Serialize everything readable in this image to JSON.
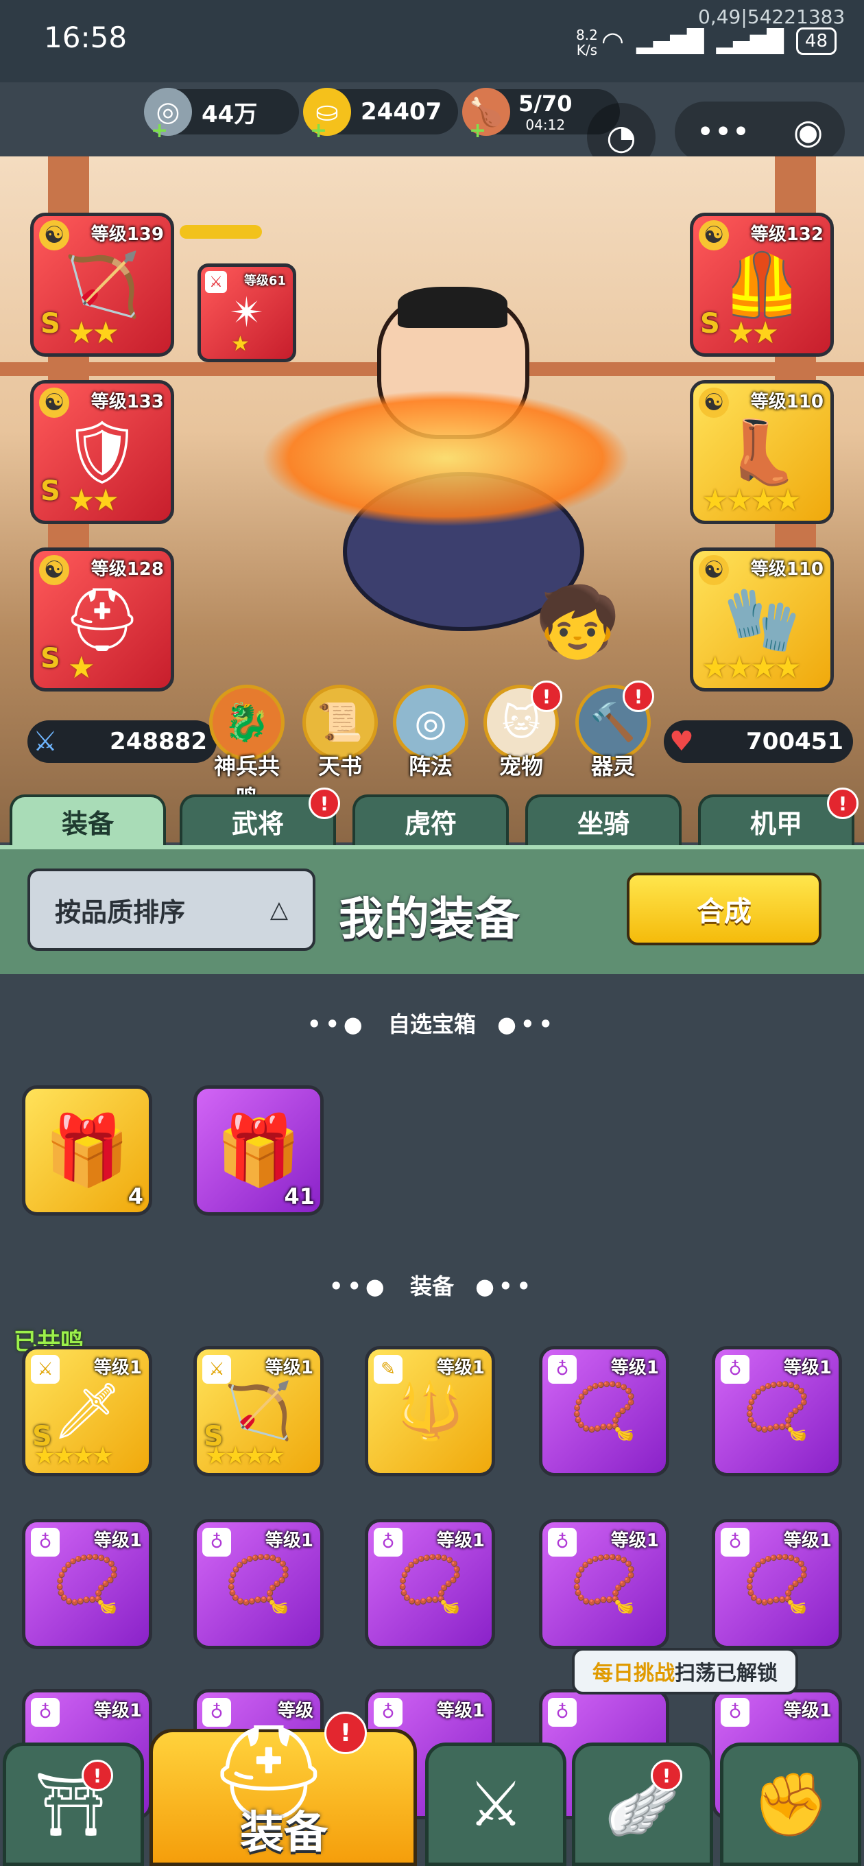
{
  "status_bar": {
    "time": "16:58",
    "net_speed_top": "8.2",
    "net_speed_unit": "K/s",
    "debug": "0,49|54221383",
    "battery": "48"
  },
  "resources": {
    "silver": "44万",
    "gold": "24407",
    "stamina": "5/70",
    "stamina_timer": "04:12"
  },
  "equipped": {
    "left": [
      {
        "level": "等级139",
        "grade": "S",
        "stars": "★★"
      },
      {
        "level": "等级133",
        "grade": "S",
        "stars": "★★"
      },
      {
        "level": "等级128",
        "grade": "S",
        "stars": "★"
      }
    ],
    "extra": {
      "level": "等级61",
      "stars": "★"
    },
    "right": [
      {
        "level": "等级132",
        "grade": "S",
        "stars": "★★"
      },
      {
        "level": "等级110",
        "stars": "★★★★"
      },
      {
        "level": "等级110",
        "stars": "★★★★"
      }
    ]
  },
  "stats": {
    "attack": "248882",
    "hp": "700451"
  },
  "features": [
    "神兵共鸣",
    "天书",
    "阵法",
    "宠物",
    "器灵"
  ],
  "tabs": [
    "装备",
    "武将",
    "虎符",
    "坐骑",
    "机甲"
  ],
  "panel": {
    "sort_label": "按品质排序",
    "title": "我的装备",
    "craft_label": "合成"
  },
  "chests_section": {
    "title": "自选宝箱",
    "items": [
      {
        "count": "4"
      },
      {
        "count": "41"
      }
    ]
  },
  "equipment_section": {
    "title": "装备",
    "resonated_label": "已共鸣",
    "row1": [
      {
        "level": "等级1",
        "grade": "S",
        "stars": "★★★★"
      },
      {
        "level": "等级1",
        "grade": "S",
        "stars": "★★★★"
      },
      {
        "level": "等级1"
      },
      {
        "level": "等级1"
      },
      {
        "level": "等级1"
      }
    ],
    "row2": [
      {
        "level": "等级1"
      },
      {
        "level": "等级1"
      },
      {
        "level": "等级1"
      },
      {
        "level": "等级1"
      },
      {
        "level": "等级1"
      }
    ],
    "row3": [
      {
        "level": "等级1"
      },
      {
        "level": "等级"
      },
      {
        "level": "等级1"
      },
      {
        "level": ""
      },
      {
        "level": "等级1"
      }
    ]
  },
  "toast": {
    "highlight": "每日挑战",
    "rest": "扫荡已解锁"
  },
  "bottom_nav": {
    "active_label": "装备"
  },
  "colors": {
    "accent_yellow": "#f5bb0b",
    "panel_green": "#5f8f72",
    "badge_red": "#e3262f"
  }
}
